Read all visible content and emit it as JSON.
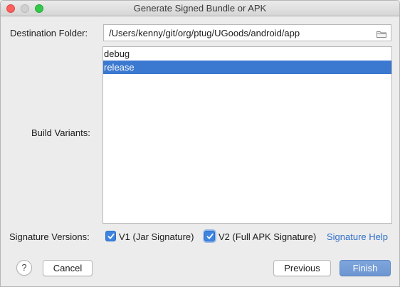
{
  "window": {
    "title": "Generate Signed Bundle or APK"
  },
  "destination": {
    "label": "Destination Folder:",
    "value": "/Users/kenny/git/org/ptug/UGoods/android/app",
    "icon": "folder-icon"
  },
  "build_variants": {
    "label": "Build Variants:",
    "items": [
      {
        "label": "debug",
        "selected": false
      },
      {
        "label": "release",
        "selected": true
      }
    ]
  },
  "signature": {
    "label": "Signature Versions:",
    "v1_label": "V1 (Jar Signature)",
    "v1_checked": true,
    "v2_label": "V2 (Full APK Signature)",
    "v2_checked": true,
    "help_link": "Signature Help"
  },
  "footer": {
    "help_symbol": "?",
    "cancel_label": "Cancel",
    "previous_label": "Previous",
    "finish_label": "Finish"
  },
  "colors": {
    "selection": "#3b78d0",
    "link": "#2f6fca",
    "checkbox": "#3d84e0"
  }
}
